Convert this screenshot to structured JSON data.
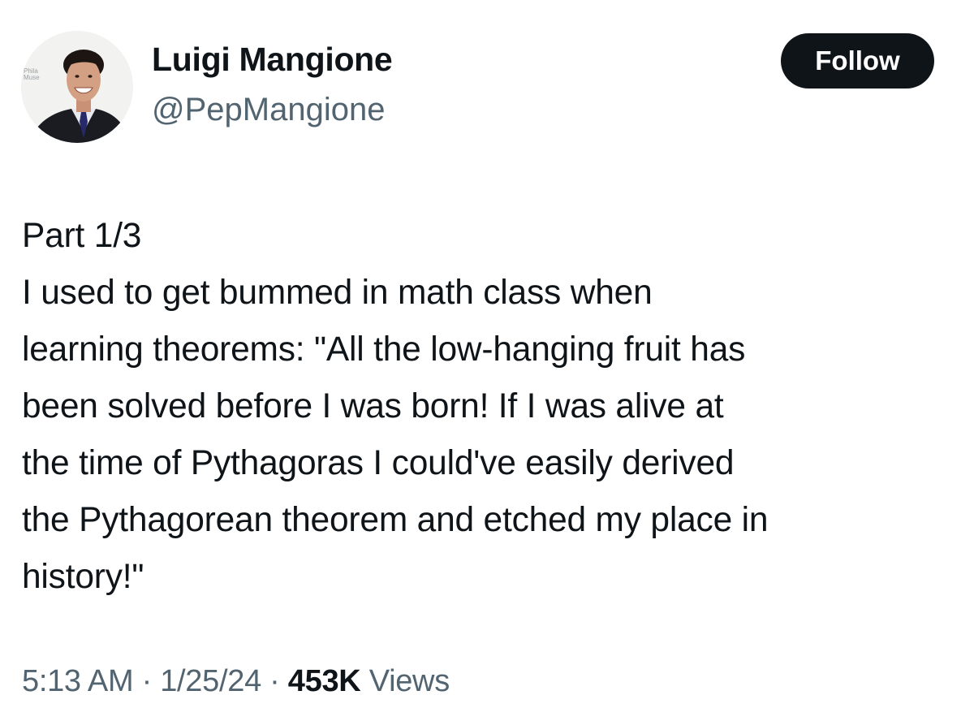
{
  "author": {
    "display_name": "Luigi Mangione",
    "handle": "@PepMangione",
    "avatar_icon": "profile-photo",
    "avatar_backdrop_text": [
      "Phila",
      "Muse"
    ]
  },
  "follow_button": {
    "label": "Follow"
  },
  "tweet": {
    "lines": [
      "Part 1/3",
      "I used to get bummed in math class when",
      "learning theorems: \"All the low-hanging fruit has",
      "been solved before I was born! If I was alive at",
      "the time of Pythagoras I could've easily derived",
      "the Pythagorean theorem and etched my place in",
      "history!\""
    ]
  },
  "meta": {
    "time": "5:13 AM",
    "separator": "·",
    "date": "1/25/24",
    "views_count": "453K",
    "views_label": "Views"
  },
  "colors": {
    "primary_text": "#0f1419",
    "secondary_text": "#536471",
    "follow_bg": "#0f1419",
    "follow_text": "#ffffff"
  }
}
